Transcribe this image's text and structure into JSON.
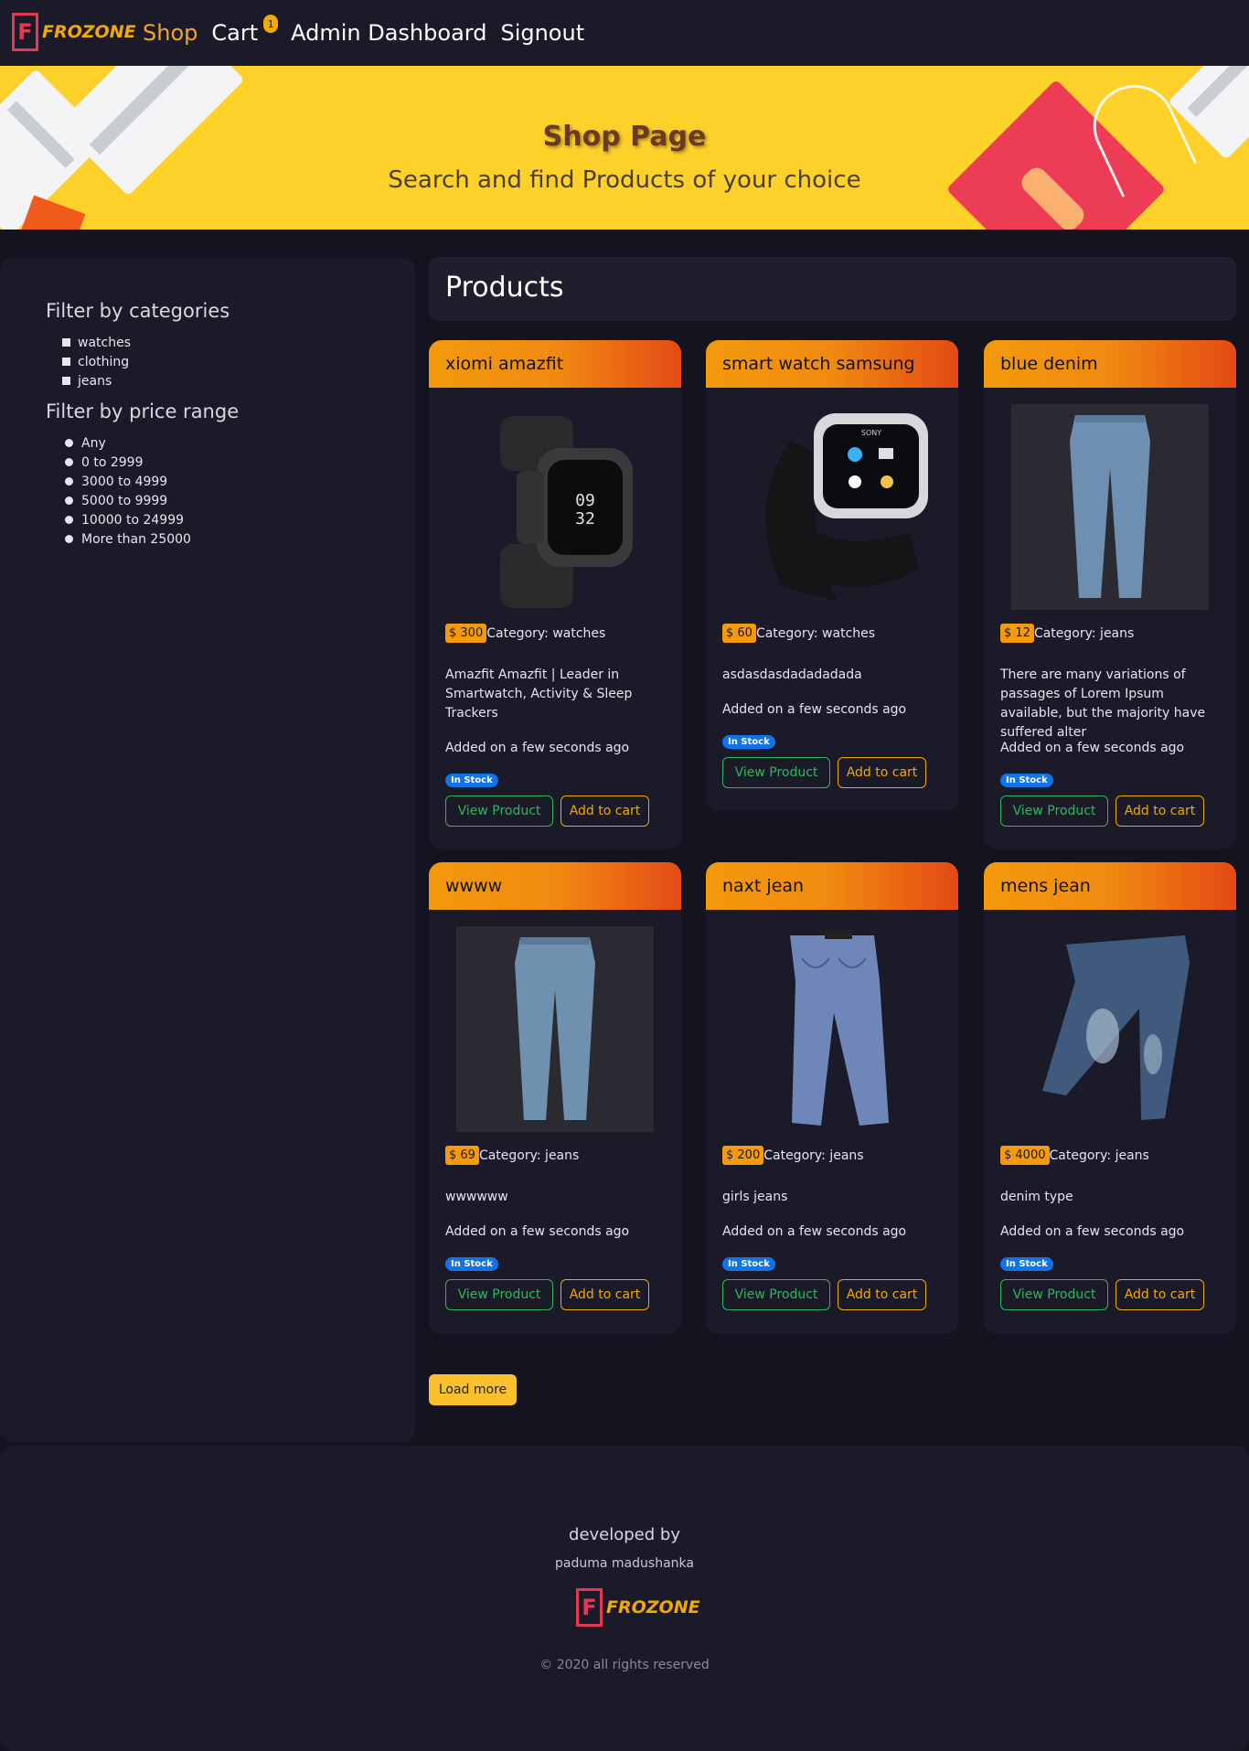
{
  "nav": {
    "logo_letter": "F",
    "logo_text": "FROZONE",
    "links": {
      "shop": "Shop",
      "cart": "Cart",
      "cart_count": "1",
      "admin": "Admin Dashboard",
      "signout": "Signout"
    }
  },
  "hero": {
    "title": "Shop Page",
    "subtitle": "Search and find Products of your choice"
  },
  "sidebar": {
    "categories_title": "Filter by categories",
    "categories": [
      "watches",
      "clothing",
      "jeans"
    ],
    "price_title": "Filter by price range",
    "price_ranges": [
      "Any",
      "0 to 2999",
      "3000 to 4999",
      "5000 to 9999",
      "10000 to 24999",
      "More than 25000"
    ]
  },
  "main": {
    "title": "Products",
    "load_more": "Load more",
    "view_label": "View Product",
    "cart_label": "Add to cart",
    "stock_label": "In Stock",
    "products": [
      {
        "name": "xiomi amazfit",
        "price": "$ 300",
        "category": "Category: watches",
        "description": "Amazfit Amazfit | Leader in Smartwatch, Activity & Sleep Trackers",
        "added": "Added on a few seconds ago",
        "image": "black-smartwatch-icon"
      },
      {
        "name": "smart watch samsung",
        "price": "$ 60",
        "category": "Category: watches",
        "description": "asdasdasdadadadada",
        "added": "Added on a few seconds ago",
        "image": "sony-smartwatch-icon"
      },
      {
        "name": "blue denim",
        "price": "$ 12",
        "category": "Category: jeans",
        "description": "There are many variations of passages of Lorem Ipsum available, but the majority have suffered alter",
        "added": "Added on a few seconds ago",
        "image": "blue-jeans-icon"
      },
      {
        "name": "wwww",
        "price": "$ 69",
        "category": "Category: jeans",
        "description": "wwwwww",
        "added": "Added on a few seconds ago",
        "image": "blue-jeans-icon"
      },
      {
        "name": "naxt jean",
        "price": "$ 200",
        "category": "Category: jeans",
        "description": "girls jeans",
        "added": "Added on a few seconds ago",
        "image": "jeans-back-icon"
      },
      {
        "name": "mens jean",
        "price": "$ 4000",
        "category": "Category: jeans",
        "description": "denim type",
        "added": "Added on a few seconds ago",
        "image": "distressed-jeans-icon"
      }
    ]
  },
  "footer": {
    "developed_by": "developed by",
    "developer": "paduma madushanka",
    "logo_letter": "F",
    "logo_text": "FROZONE",
    "copyright": "© 2020 all rights reserved"
  },
  "colors": {
    "background": "#141320",
    "panel": "#1b1a29",
    "accent": "#f2a900",
    "header_gradient_start": "#f39a0b",
    "header_gradient_end": "#e34a15",
    "success": "#2eb85c",
    "badge": "#1273e6"
  }
}
